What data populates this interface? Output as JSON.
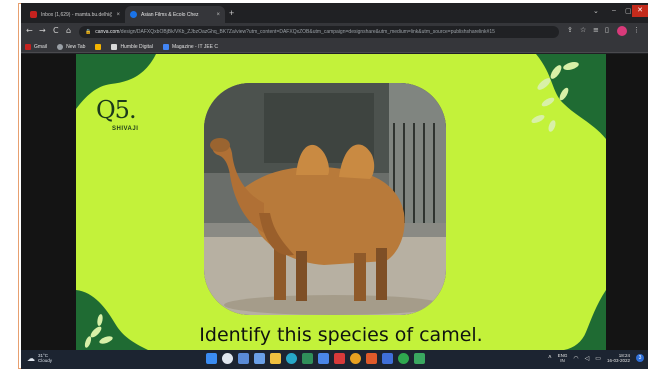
{
  "browser": {
    "tabs": [
      {
        "label": "Inbox (1,629) - mamta.bu.delhi@...",
        "close": "×",
        "color": "#c5221f",
        "active": false
      },
      {
        "label": "Asian Films & Ecolo Chez",
        "close": "×",
        "color": "#1a73e8",
        "active": true
      }
    ],
    "new_tab": "+",
    "window_controls": {
      "minimize": "⌄",
      "restore": "▢",
      "maximize": "–",
      "close": "✕"
    },
    "nav": {
      "back": "←",
      "forward": "→",
      "reload": "C",
      "home": "⌂"
    },
    "url_domain": "canva.com",
    "url_path": "/design/DAFXQxbOBjBk/VKb_ZJbzOazGhq_BK7Za/view?utm_content=DAFXQxZOB&utm_campaign=designshare&utm_medium=link&utm_source=publishsharelink#15",
    "bookmarks": [
      {
        "label": "Gmail",
        "color": "#c5221f"
      },
      {
        "label": "New Tab",
        "color": "#9aa0a6"
      },
      {
        "label": "",
        "color": "#f4b400"
      },
      {
        "label": "Humble Digital",
        "color": "#d8d8d8"
      },
      {
        "label": "Magazine - IT JEE C",
        "color": "#4285f4"
      }
    ]
  },
  "slide": {
    "number": "Q5.",
    "subtitle": "SHIVAJI",
    "caption": "Identify this species of camel."
  },
  "taskbar": {
    "weather_temp": "31°C",
    "weather_cond": "Cloudy",
    "lang": "ENG",
    "lang_region": "IN",
    "time": "18:24",
    "date": "16-03-2022",
    "notifications": "3",
    "app_colors": [
      "#3b8cf2",
      "#dfe6ee",
      "#5a8bd6",
      "#6aa0e8",
      "#f0c040",
      "#27a8c8",
      "#2f8f5a",
      "#4a86e8",
      "#d83a3a",
      "#e8a020",
      "#3f6fd8",
      "#5fb8e8",
      "#2fa84f",
      "#3aa860"
    ]
  }
}
